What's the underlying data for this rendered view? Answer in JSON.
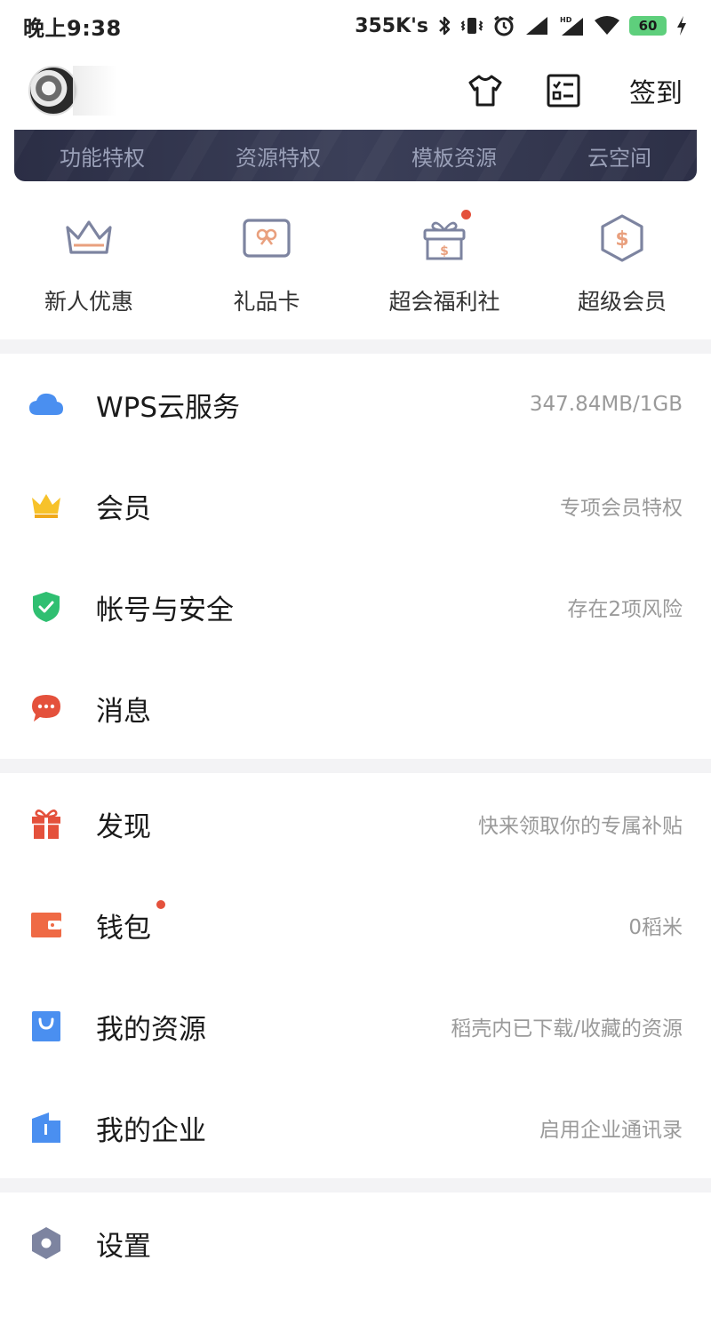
{
  "status_bar": {
    "time": "晚上9:38",
    "network_speed": "355K's",
    "battery": "60"
  },
  "header": {
    "signin_label": "签到",
    "icons": [
      "shirt-icon",
      "checklist-icon"
    ]
  },
  "banner": {
    "tabs": [
      "功能特权",
      "资源特权",
      "模板资源",
      "云空间"
    ]
  },
  "quick_actions": [
    {
      "label": "新人优惠",
      "icon": "crown-outline-icon"
    },
    {
      "label": "礼品卡",
      "icon": "gift-card-icon"
    },
    {
      "label": "超会福利社",
      "icon": "gift-box-icon"
    },
    {
      "label": "超级会员",
      "icon": "hexagon-dollar-icon"
    }
  ],
  "menu": {
    "group1": [
      {
        "title": "WPS云服务",
        "value": "347.84MB/1GB",
        "icon": "cloud-icon"
      },
      {
        "title": "会员",
        "value": "专项会员特权",
        "icon": "crown-icon"
      },
      {
        "title": "帐号与安全",
        "value": "存在2项风险",
        "icon": "shield-check-icon"
      },
      {
        "title": "消息",
        "value": "",
        "icon": "chat-bubble-icon"
      }
    ],
    "group2": [
      {
        "title": "发现",
        "value": "快来领取你的专属补贴",
        "icon": "gift-icon"
      },
      {
        "title": "钱包",
        "value": "0稻米",
        "icon": "wallet-icon"
      },
      {
        "title": "我的资源",
        "value": "稻壳内已下载/收藏的资源",
        "icon": "bag-icon"
      },
      {
        "title": "我的企业",
        "value": "启用企业通讯录",
        "icon": "building-icon"
      }
    ],
    "group3": [
      {
        "title": "设置",
        "value": "",
        "icon": "settings-hexagon-icon"
      }
    ]
  },
  "colors": {
    "accent_red": "#e4513c",
    "cloud_blue": "#4a8ff0",
    "crown_yellow": "#f7c22a",
    "shield_green": "#2fbf71",
    "wallet_orange": "#ef6a45",
    "settings_gray": "#7d84a0"
  }
}
